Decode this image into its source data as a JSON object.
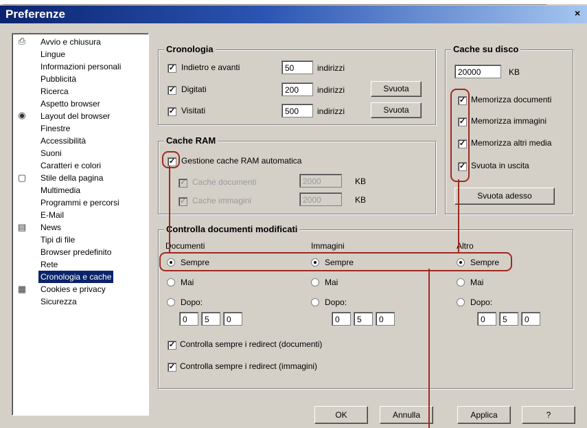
{
  "window": {
    "title": "Preferenze",
    "close": "×"
  },
  "sidebar": {
    "items": [
      {
        "label": "Avvio e chiusura",
        "icon": "printer-icon"
      },
      {
        "label": "Lingue"
      },
      {
        "label": "Informazioni personali"
      },
      {
        "label": "Pubblicità"
      },
      {
        "label": "Ricerca"
      },
      {
        "label": "Aspetto browser",
        "icon": "eye-icon"
      },
      {
        "label": "Layout del browser"
      },
      {
        "label": "Finestre"
      },
      {
        "label": "Accessibilità"
      },
      {
        "label": "Suoni"
      },
      {
        "label": "Caratteri e colori",
        "icon": "page-icon"
      },
      {
        "label": "Stile della pagina"
      },
      {
        "label": "Multimedia"
      },
      {
        "label": "Programmi e percorsi",
        "icon": "list-icon"
      },
      {
        "label": "E-Mail"
      },
      {
        "label": "News"
      },
      {
        "label": "Tipi di file"
      },
      {
        "label": "Browser predefinito"
      },
      {
        "label": "Rete",
        "icon": "network-icon"
      },
      {
        "label": "Cronologia e cache",
        "selected": true
      },
      {
        "label": "Cookies e privacy"
      },
      {
        "label": "Sicurezza"
      }
    ]
  },
  "cronologia": {
    "title": "Cronologia",
    "rows": [
      {
        "label": "Indietro e avanti",
        "value": "50",
        "unit": "indirizzi"
      },
      {
        "label": "Digitati",
        "value": "200",
        "unit": "indirizzi",
        "button": "Svuota"
      },
      {
        "label": "Visitati",
        "value": "500",
        "unit": "indirizzi",
        "button": "Svuota"
      }
    ]
  },
  "cache_disco": {
    "title": "Cache su disco",
    "value": "20000",
    "unit": "KB",
    "options": [
      "Memorizza documenti",
      "Memorizza immagini",
      "Memorizza altri media",
      "Svuota in uscita"
    ],
    "button": "Svuota adesso"
  },
  "cache_ram": {
    "title": "Cache RAM",
    "auto_label": "Gestione cache RAM automatica",
    "rows": [
      {
        "label": "Cache documenti",
        "value": "2000",
        "unit": "KB"
      },
      {
        "label": "Cache immagini",
        "value": "2000",
        "unit": "KB"
      }
    ]
  },
  "controlla": {
    "title": "Controlla documenti modificati",
    "columns": [
      {
        "header": "Documenti",
        "sempre": "Sempre",
        "mai": "Mai",
        "dopo": "Dopo:",
        "fields": [
          "0",
          "5",
          "0"
        ]
      },
      {
        "header": "Immagini",
        "sempre": "Sempre",
        "mai": "Mai",
        "dopo": "Dopo:",
        "fields": [
          "0",
          "5",
          "0"
        ]
      },
      {
        "header": "Altro",
        "sempre": "Sempre",
        "mai": "Mai",
        "dopo": "Dopo:",
        "fields": [
          "0",
          "5",
          "0"
        ]
      }
    ],
    "redirect_docs": "Controlla sempre i redirect (documenti)",
    "redirect_imgs": "Controlla sempre i redirect (immagini)"
  },
  "footer": {
    "ok": "OK",
    "cancel": "Annulla",
    "apply": "Applica",
    "help": "?"
  },
  "check_mark": "✓",
  "accent_color": "#a0281e"
}
